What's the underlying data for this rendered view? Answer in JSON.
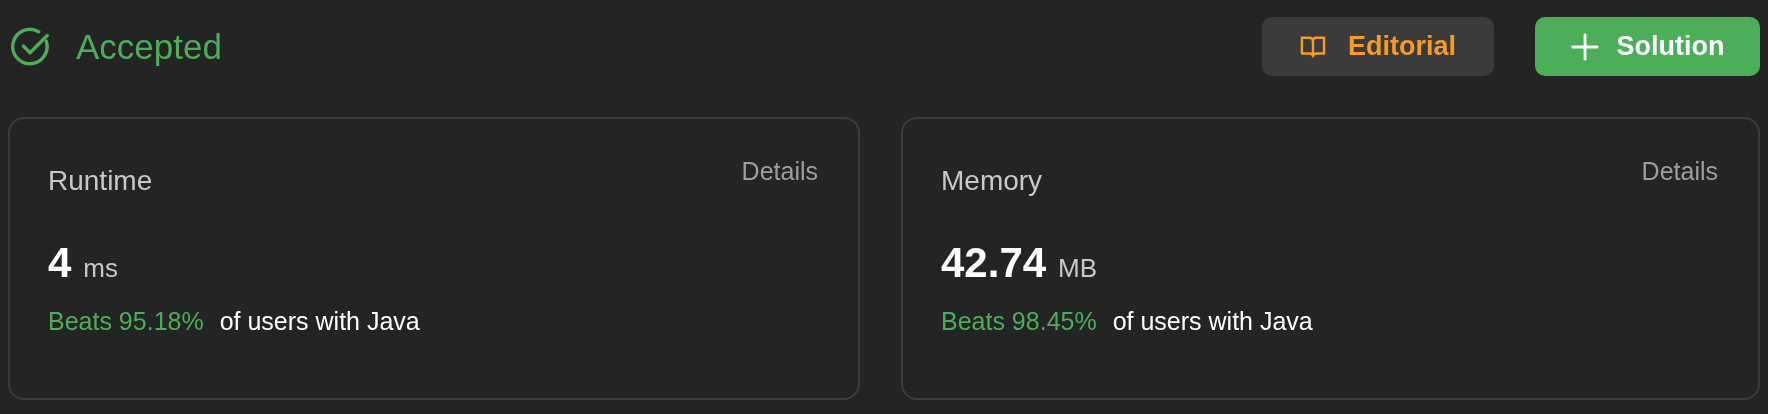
{
  "status": {
    "label": "Accepted"
  },
  "buttons": [
    {
      "kind": "editorial",
      "label": "Editorial"
    },
    {
      "kind": "solution",
      "label": "Solution"
    }
  ],
  "cards": [
    {
      "title": "Runtime",
      "link": "Details",
      "value": "4",
      "unit": "ms",
      "beats": "Beats 95.18%",
      "suffix": "of users with Java"
    },
    {
      "title": "Memory",
      "link": "Details",
      "value": "42.74",
      "unit": "MB",
      "beats": "Beats 98.45%",
      "suffix": "of users with Java"
    }
  ]
}
